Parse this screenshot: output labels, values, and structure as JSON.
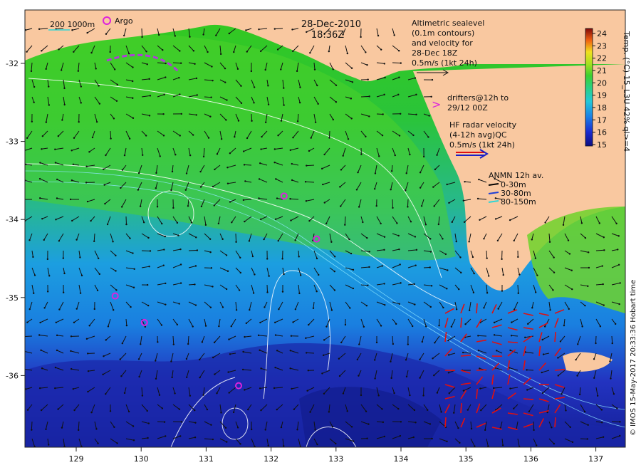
{
  "header": {
    "date": "28-Dec-2010",
    "time": "18:36Z"
  },
  "scale_legend": {
    "isobath_label": "200  1000m",
    "argo_label": "Argo"
  },
  "altimetry_legend": {
    "lines": [
      "Altimetric sealevel",
      "(0.1m contours)",
      "and velocity for",
      "28-Dec 18Z",
      "0.5m/s (1kt 24h)"
    ]
  },
  "drifter_legend": {
    "symbol": ">",
    "lines": [
      "drifters@12h to",
      "29/12 00Z"
    ]
  },
  "hf_radar_legend": {
    "lines": [
      "HF radar velocity",
      "(4-12h avg)QC",
      "0.5m/s (1kt 24h)"
    ]
  },
  "anmn_legend": {
    "title": "ANMN 12h av.",
    "items": [
      {
        "label": "0-30m",
        "color": "#000000"
      },
      {
        "label": "30-80m",
        "color": "#1f3fd6"
      },
      {
        "label": "80-150m",
        "color": "#2fd6d6"
      }
    ]
  },
  "colorbar": {
    "label": "Temp. (°C) 15_L3U 42% ql>=4",
    "ticks": [
      "24",
      "23",
      "22",
      "21",
      "20",
      "19",
      "18",
      "17",
      "16",
      "15"
    ],
    "min": 15,
    "max": 24.5
  },
  "credit": "© IMOS 15-May-2017 20:33:36 Hobart time",
  "axes": {
    "x_ticks": [
      "129",
      "130",
      "131",
      "132",
      "133",
      "134",
      "135",
      "136",
      "137"
    ],
    "y_ticks": [
      "-32",
      "-33",
      "-34",
      "-35",
      "-36"
    ]
  },
  "argo_floats": [
    {
      "lon": 132.2,
      "lat": -33.7
    },
    {
      "lon": 132.7,
      "lat": -34.25
    },
    {
      "lon": 129.6,
      "lat": -34.98
    },
    {
      "lon": 130.05,
      "lat": -35.32
    },
    {
      "lon": 131.5,
      "lat": -36.13
    }
  ],
  "colors": {
    "land": "#f9c8a0",
    "argo": "#dd22dd",
    "drifter": "#b03cd8",
    "hf_radar": "#e01010",
    "hf_radar_legend_blue": "#1a20c8"
  }
}
